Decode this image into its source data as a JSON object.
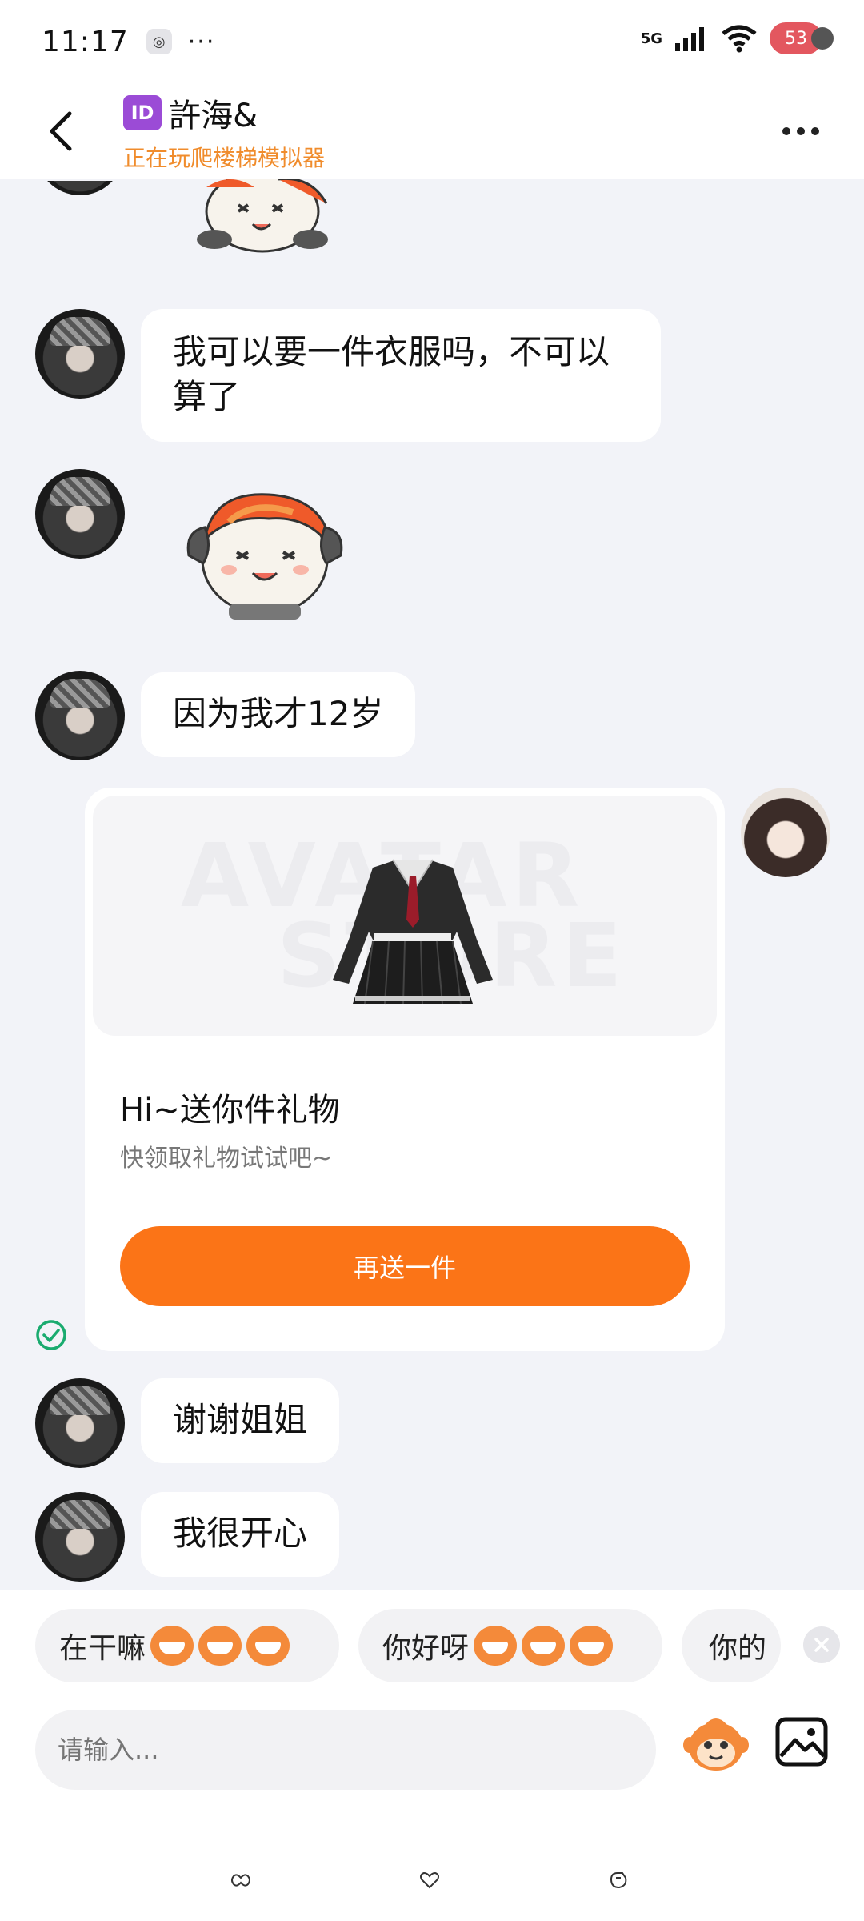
{
  "status_bar": {
    "time": "11:17",
    "network": "5G",
    "battery": "53"
  },
  "header": {
    "id_badge": "ID",
    "title": "許海&",
    "subtitle": "正在玩爬楼梯模拟器"
  },
  "messages": [
    {
      "sender": "other",
      "type": "text",
      "text": "我可以要一件衣服吗，不可以\n算了"
    },
    {
      "sender": "other",
      "type": "sticker"
    },
    {
      "sender": "other",
      "type": "text",
      "text": "因为我才12岁"
    },
    {
      "sender": "self",
      "type": "gift"
    },
    {
      "sender": "other",
      "type": "text",
      "text": "谢谢姐姐"
    },
    {
      "sender": "other",
      "type": "text",
      "text": "我很开心"
    }
  ],
  "gift_card": {
    "title": "Hi~送你件礼物",
    "subtitle": "快领取礼物试试吧~",
    "button_label": "再送一件",
    "watermark": [
      "AVATAR",
      "STORE"
    ]
  },
  "quick_replies": [
    {
      "text": "在干嘛",
      "emoji_count": 3
    },
    {
      "text": "你好呀",
      "emoji_count": 3
    },
    {
      "text": "你的"
    }
  ],
  "input": {
    "placeholder": "请输入..."
  },
  "colors": {
    "accent_orange": "#fb7417",
    "subtitle_orange": "#f08c2c",
    "id_badge_purple": "#9b4bd6",
    "chat_background": "#f2f3f8"
  }
}
